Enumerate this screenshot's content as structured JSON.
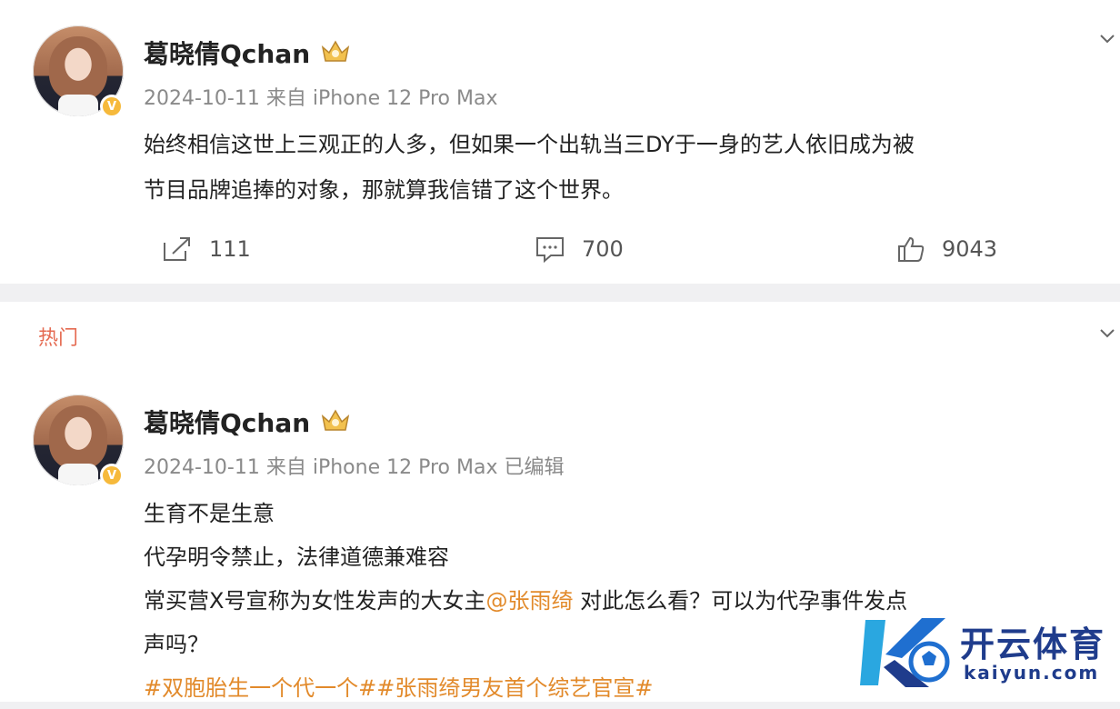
{
  "post1": {
    "author": "葛晓倩Qchan",
    "meta": "2024-10-11  来自 iPhone 12 Pro Max",
    "lines": [
      "始终相信这世上三观正的人多，但如果一个出轨当三DY于一身的艺人依旧成为被",
      "节目品牌追捧的对象，那就算我信错了这个世界。"
    ],
    "actions": {
      "repost": "111",
      "comment": "700",
      "like": "9043"
    }
  },
  "section": {
    "hot": "热门"
  },
  "post2": {
    "author": "葛晓倩Qchan",
    "meta": "2024-10-11  来自 iPhone 12 Pro Max 已编辑",
    "line1": "生育不是生意",
    "line2": "代孕明令禁止，法律道德兼难容",
    "line3_pre": "常买营X号宣称为女性发声的大女主",
    "line3_mention": "@张雨绮",
    "line3_post": " 对此怎么看？可以为代孕事件发点",
    "line4": "声吗？",
    "tags": "#双胞胎生一个代一个##张雨绮男友首个综艺官宣#"
  },
  "watermark": {
    "cn": "开云体育",
    "en": "kaiyun.com"
  },
  "icons": {
    "verified": "V",
    "crown": "crown-badge-icon",
    "repost": "repost-icon",
    "comment": "comment-icon",
    "like": "thumbs-up-icon",
    "more": "chevron-down-icon"
  },
  "colors": {
    "accent": "#e28a2b",
    "hot": "#e56b52",
    "muted": "#8a8a8a"
  }
}
